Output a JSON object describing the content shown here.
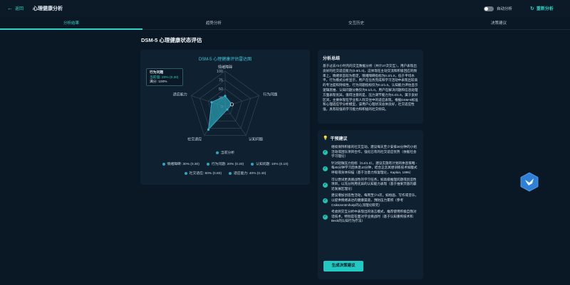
{
  "header": {
    "back_label": "返回",
    "title": "心理健康分析",
    "auto_label": "自动分析",
    "reanalyze_label": "重新分析"
  },
  "tabs": [
    "分析结果",
    "趋势分析",
    "交互历史",
    "决策建议"
  ],
  "active_tab": 0,
  "section_title": "DSM-5 心理健康状态评估",
  "tooltip": {
    "title": "行为问题",
    "value": "当前值: 20% (0.20)",
    "full": "满分: 100%"
  },
  "chart_data": {
    "type": "radar",
    "title": "DSM-5 心理健康评估雷达图",
    "axes": [
      "情绪障碍",
      "行为问题",
      "认知问题",
      "社交适应",
      "适应能力"
    ],
    "ticks": [
      0,
      25,
      50,
      75,
      100
    ],
    "range": [
      0,
      100
    ],
    "series": [
      {
        "name": "当前分析",
        "values": [
          30,
          20,
          10,
          80,
          40
        ]
      }
    ],
    "legend_placement": "bottom",
    "colors": {
      "fill": "#2a9bb0",
      "stroke": "#36b6c9",
      "grid": "#3c4b5a"
    }
  },
  "legend": {
    "items": [
      "情绪障碍: 30% (0.30)",
      "行为问题: 20% (0.20)",
      "认知问题: 10% (0.10)",
      "社交适应: 80% (0.80)",
      "适应能力: 40% (0.40)"
    ]
  },
  "summary": {
    "title": "分析总结",
    "text": "基于过去72小时内的交互数据分析（共计27次交互），用户表现出良好的社交适应能力(0.8/1.0)，这体现在主动交流和积极回应的频率上。情绪状态较为稳定，情绪障碍指标为0.3/1.0，低于平均水平。行为模式分析显示，用户在任务完成和学习活动中表现出较高的专注度和持续性，行为问题指标仅为0.2/1.0。认知能力评估显示逻辑思维、认知问题分数仅为0.1/1.0，用户在解决问题和信息处理方面表现优异。值得注意的是，压力调节能力为0.4/1.0，属于良好区间，主要体现在学业和人际交往中的适应表现。根据DSM-5标准和心理适应学分析模型，该用户心理状况总体良好，社交适应性强，具有较强的学习能力和积极的社交倾向。"
  },
  "intervention": {
    "title": "干预建议",
    "items": [
      "继续保持积极的社交互动，建议每天至少安排30分钟的小组活动或团队项目合作，强化已有的社交适应优势（依据社会学习理论）",
      "针对轻微压力指标（0.4/1.0），建议实施有计划的休息策略 - 每45分钟学习后休息10分钟，结合正念冥想训练技术如腹式呼吸或身体扫描（基于注意力恢复理论，Kaplan, 1995）",
      "可以尝试更具挑战性的学习任务，如高级推理问题或创造性项目，以充分利用优异的认知能力表现（基于维果茨基的最近发展区理论）",
      "建议增加创造性活动，每周至少3次，如绘画、写作或音乐，以提供情绪表达的健康渠道，预防压力累积（参考Csikszentmihalyi的心流理论研究）",
      "考虑到交互分析中表现出的语言模式，推荐使用积极自我对话技术，特别是在面对学业挑战时（基于认知重构技术和Beck的认知行为疗法）"
    ],
    "button_label": "生成决策建议"
  },
  "icons": {
    "back": "arrow-left-icon",
    "refresh": "refresh-icon",
    "bulb": "lightbulb-icon",
    "check": "check-circle-icon",
    "widget": "bird-logo-icon"
  }
}
